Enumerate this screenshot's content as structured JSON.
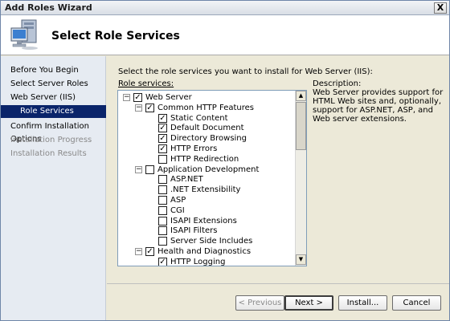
{
  "window": {
    "title": "Add Roles Wizard",
    "close_label": "X"
  },
  "header": {
    "title": "Select Role Services"
  },
  "sidebar": {
    "steps": [
      {
        "label": "Before You Begin",
        "state": "normal"
      },
      {
        "label": "Select Server Roles",
        "state": "normal"
      },
      {
        "label": "Web Server (IIS)",
        "state": "normal"
      },
      {
        "label": "Role Services",
        "state": "active"
      },
      {
        "label": "Confirm Installation Options",
        "state": "normal"
      },
      {
        "label": "Installation Progress",
        "state": "disabled"
      },
      {
        "label": "Installation Results",
        "state": "disabled"
      }
    ]
  },
  "main": {
    "instruction": "Select the role services you want to install for Web Server (IIS):",
    "role_services_label": "Role services:",
    "description_label": "Description:",
    "description_text": "Web Server provides support for HTML Web sites and, optionally, support for ASP.NET, ASP, and Web server extensions.",
    "tree": [
      {
        "label": "Web Server",
        "level": 0,
        "checked": true,
        "expander": "minus"
      },
      {
        "label": "Common HTTP Features",
        "level": 1,
        "checked": true,
        "expander": "minus"
      },
      {
        "label": "Static Content",
        "level": 2,
        "checked": true
      },
      {
        "label": "Default Document",
        "level": 2,
        "checked": true
      },
      {
        "label": "Directory Browsing",
        "level": 2,
        "checked": true
      },
      {
        "label": "HTTP Errors",
        "level": 2,
        "checked": true
      },
      {
        "label": "HTTP Redirection",
        "level": 2,
        "checked": false
      },
      {
        "label": "Application Development",
        "level": 1,
        "checked": false,
        "expander": "minus"
      },
      {
        "label": "ASP.NET",
        "level": 2,
        "checked": false
      },
      {
        "label": ".NET Extensibility",
        "level": 2,
        "checked": false
      },
      {
        "label": "ASP",
        "level": 2,
        "checked": false
      },
      {
        "label": "CGI",
        "level": 2,
        "checked": false
      },
      {
        "label": "ISAPI Extensions",
        "level": 2,
        "checked": false
      },
      {
        "label": "ISAPI Filters",
        "level": 2,
        "checked": false
      },
      {
        "label": "Server Side Includes",
        "level": 2,
        "checked": false
      },
      {
        "label": "Health and Diagnostics",
        "level": 1,
        "checked": true,
        "expander": "minus"
      },
      {
        "label": "HTTP Logging",
        "level": 2,
        "checked": true
      }
    ]
  },
  "buttons": {
    "previous": "< Previous",
    "next": "Next >",
    "install": "Install...",
    "cancel": "Cancel"
  },
  "icons": {
    "wizard": "computer-roles-icon",
    "scroll_up": "scroll-up-arrow-icon",
    "scroll_down": "scroll-down-arrow-icon"
  }
}
